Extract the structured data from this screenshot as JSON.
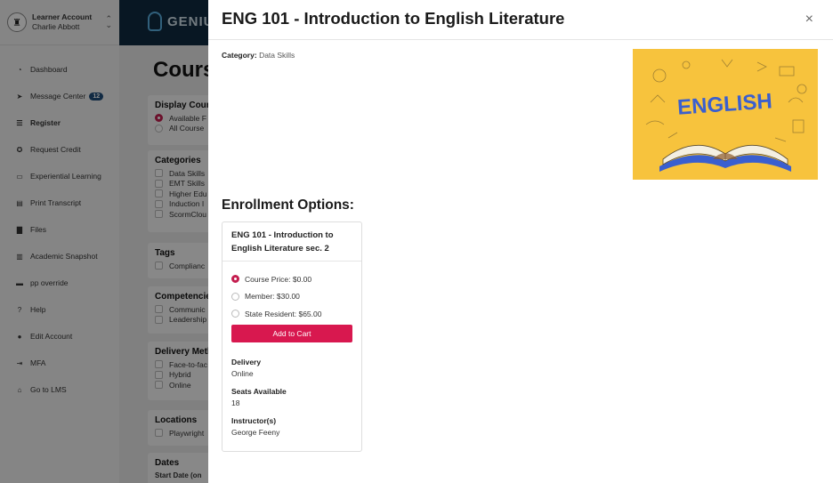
{
  "account": {
    "title": "Learner Account",
    "name": "Charlie Abbott"
  },
  "sidebar": {
    "items": [
      {
        "label": "Dashboard",
        "icon": "dashboard-icon",
        "glyph": "◔"
      },
      {
        "label": "Message Center",
        "icon": "send-icon",
        "glyph": "➤",
        "badge": "12"
      },
      {
        "label": "Register",
        "icon": "register-icon",
        "glyph": "☰"
      },
      {
        "label": "Request Credit",
        "icon": "credit-icon",
        "glyph": "✪"
      },
      {
        "label": "Experiential Learning",
        "icon": "laptop-icon",
        "glyph": "▭"
      },
      {
        "label": "Print Transcript",
        "icon": "document-icon",
        "glyph": "▤"
      },
      {
        "label": "Files",
        "icon": "file-icon",
        "glyph": "▇"
      },
      {
        "label": "Academic Snapshot",
        "icon": "chart-icon",
        "glyph": "▥"
      },
      {
        "label": "pp override",
        "icon": "card-icon",
        "glyph": "▬"
      },
      {
        "label": "Help",
        "icon": "help-icon",
        "glyph": "?"
      },
      {
        "label": "Edit Account",
        "icon": "user-icon",
        "glyph": "●"
      },
      {
        "label": "MFA",
        "icon": "login-icon",
        "glyph": "⇥"
      },
      {
        "label": "Go to LMS",
        "icon": "graduation-cap-icon",
        "glyph": "⌂"
      }
    ]
  },
  "topbar": {
    "logo_text": "GENIU"
  },
  "main": {
    "title": "Cours",
    "display": {
      "heading": "Display Cours",
      "options": [
        "Available F",
        "All Course"
      ]
    },
    "categories": {
      "heading": "Categories",
      "options": [
        "Data Skills",
        "EMT Skills",
        "Higher Edu",
        "Induction I",
        "ScormClou"
      ]
    },
    "tags": {
      "heading": "Tags",
      "options": [
        "Complianc"
      ]
    },
    "competencies": {
      "heading": "Competencie",
      "options": [
        "Communic",
        "Leadership"
      ]
    },
    "delivery": {
      "heading": "Delivery Meth",
      "options": [
        "Face-to-fac",
        "Hybrid",
        "Online"
      ]
    },
    "locations": {
      "heading": "Locations",
      "options": [
        "Playwright"
      ]
    },
    "dates": {
      "heading": "Dates",
      "start_label": "Start Date (on"
    }
  },
  "modal": {
    "title": "ENG 101 - Introduction to English Literature",
    "close": "×",
    "category_label": "Category:",
    "category_value": "Data Skills",
    "hero_word": "ENGLISH",
    "enrollment_heading": "Enrollment Options:",
    "section": {
      "title": "ENG 101 - Introduction to English Literature sec. 2",
      "prices": [
        {
          "label": "Course Price: $0.00",
          "selected": true
        },
        {
          "label": "Member: $30.00",
          "selected": false
        },
        {
          "label": "State Resident: $65.00",
          "selected": false
        }
      ],
      "add_to_cart": "Add to Cart",
      "delivery_label": "Delivery",
      "delivery_value": "Online",
      "seats_label": "Seats Available",
      "seats_value": "18",
      "instructor_label": "Instructor(s)",
      "instructor_value": "George Feeny"
    }
  },
  "colors": {
    "accent": "#d8184f",
    "navy": "#0f2a40",
    "badge": "#1f4d7a",
    "hero_bg": "#f7c33d",
    "hero_text": "#3a5fcf"
  }
}
